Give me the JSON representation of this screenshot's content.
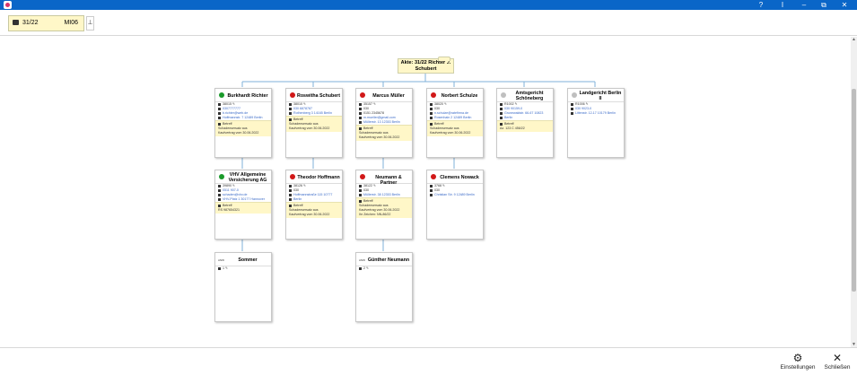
{
  "window": {
    "help": "?",
    "cursor_btn": "I",
    "minimize": "–",
    "restore": "⧉",
    "close": "✕"
  },
  "toolbar": {
    "file_number": "31/22",
    "file_code": "MI06",
    "pin_icon": "pin-icon"
  },
  "root": {
    "line1": "Akte: 31/22 Richter ./.",
    "line2": "Schubert"
  },
  "cards": [
    {
      "id": "richter",
      "name": "Burkhardt Richter",
      "status_color": "#1a9a2a",
      "lines": [
        [
          "d",
          "38015 ✎",
          false
        ],
        [
          "p",
          "0307777777",
          true
        ],
        [
          "e",
          "b.richter@web.de",
          true
        ],
        [
          "h",
          "Hoffmannstr. 7 12489 Berlin",
          true
        ]
      ],
      "yellow": [
        "Betreff",
        "Schadensersatz aus",
        "Kaufvertrag vom 30.06.2022"
      ]
    },
    {
      "id": "schubert",
      "name": "Roswitha Schubert",
      "status_color": "#d11818",
      "lines": [
        [
          "d",
          "38010 ✎",
          false
        ],
        [
          "p",
          "030 6878787",
          true
        ],
        [
          "h",
          "Rothenberg 3 14165 Berlin",
          true
        ]
      ],
      "yellow": [
        "Betreff",
        "Schadensersatz aus",
        "Kaufvertrag vom 30.06.2022"
      ]
    },
    {
      "id": "mueller",
      "name": "Marcus Müller",
      "status_color": "#d11818",
      "lines": [
        [
          "d",
          "35157 ✎",
          false
        ],
        [
          "p",
          "030",
          false
        ],
        [
          "p",
          "0151 2345678",
          false
        ],
        [
          "e",
          "m.mueller@gmail.com",
          true
        ],
        [
          "h",
          "Müllerstr. 13 12353 Berlin",
          true
        ]
      ],
      "yellow": [
        "Betreff",
        "Schadensersatz aus",
        "Kaufvertrag vom 30.06.2022"
      ]
    },
    {
      "id": "schulze",
      "name": "Norbert Schulze",
      "status_color": "#d11818",
      "lines": [
        [
          "d",
          "38020 ✎",
          false
        ],
        [
          "p",
          "030",
          false
        ],
        [
          "e",
          "n.schulze@ratefirma.de",
          true
        ],
        [
          "h",
          "Rosenhain 2 12489 Berlin",
          true
        ]
      ],
      "yellow": [
        "Betreff",
        "Schadensersatz aus",
        "Kaufvertrag vom 30.06.2022"
      ]
    },
    {
      "id": "amtsgericht",
      "name": "Amtsgericht Schöneberg",
      "status_color": "#bfbfbf",
      "lines": [
        [
          "d",
          "R1002 ✎",
          false
        ],
        [
          "p",
          "030 90159-0",
          true
        ],
        [
          "h",
          "Grunewaldstr. 66-67 10823",
          true
        ],
        [
          "h",
          "Berlin",
          true
        ]
      ],
      "yellow": [
        "Betreff",
        "Az. 123 C 456/22"
      ]
    },
    {
      "id": "landgericht",
      "name": "Landgericht Berlin II",
      "status_color": "#bfbfbf",
      "lines": [
        [
          "d",
          "R1006 ✎",
          false
        ],
        [
          "p",
          "030 9023-0",
          true
        ],
        [
          "h",
          "Littenstr. 12-17 10179 Berlin",
          true
        ]
      ],
      "yellow": []
    },
    {
      "id": "vhv",
      "name": "VHV Allgemeine Versicherung AG",
      "status_color": "#1a9a2a",
      "lines": [
        [
          "d",
          "39890 ✎",
          false
        ],
        [
          "p",
          "0511 907-0",
          true
        ],
        [
          "e",
          "schaden@vhv.de",
          true
        ],
        [
          "h",
          "VHV-Platz 1 30177 Hannover",
          true
        ]
      ],
      "yellow": [
        "Betreff",
        "RS 987654321"
      ]
    },
    {
      "id": "hoffmann",
      "name": "Theodor Hoffmann",
      "status_color": "#d11818",
      "lines": [
        [
          "d",
          "38126 ✎",
          false
        ],
        [
          "p",
          "030",
          false
        ],
        [
          "h",
          "Hoffmannstraße 115 10777",
          true
        ],
        [
          "h",
          "Berlin",
          true
        ]
      ],
      "yellow": [
        "Betreff",
        "Schadensersatz aus",
        "Kaufvertrag vom 30.06.2022"
      ]
    },
    {
      "id": "neumann",
      "name": "Neumann & Partner",
      "status_color": "#d11818",
      "lines": [
        [
          "d",
          "38122 ✎",
          false
        ],
        [
          "p",
          "030",
          false
        ],
        [
          "h",
          "Müllerstr. 38 12353 Berlin",
          true
        ]
      ],
      "yellow": [
        "Betreff",
        "Schadensersatz aus",
        "Kaufvertrag vom 30.06.2022",
        "Ihr Zeichen: NN-86/22"
      ]
    },
    {
      "id": "nowack",
      "name": "Clemens Nowack",
      "status_color": "#d11818",
      "lines": [
        [
          "d",
          "3768 ✎",
          false
        ],
        [
          "p",
          "030",
          false
        ],
        [
          "h",
          "Christian Str. 9 12489 Berlin",
          true
        ]
      ],
      "yellow": []
    },
    {
      "id": "sommer",
      "name": "Sommer",
      "status_color": "",
      "kind": "ANW",
      "lines": [
        [
          "d",
          "1 ✎",
          false
        ]
      ],
      "yellow": []
    },
    {
      "id": "gneumann",
      "name": "Günther Neumann",
      "status_color": "",
      "kind": "ANW",
      "lines": [
        [
          "d",
          "2 ✎",
          false
        ]
      ],
      "yellow": []
    }
  ],
  "bottom": {
    "settings_label": "Einstellungen",
    "close_label": "Schließen"
  }
}
